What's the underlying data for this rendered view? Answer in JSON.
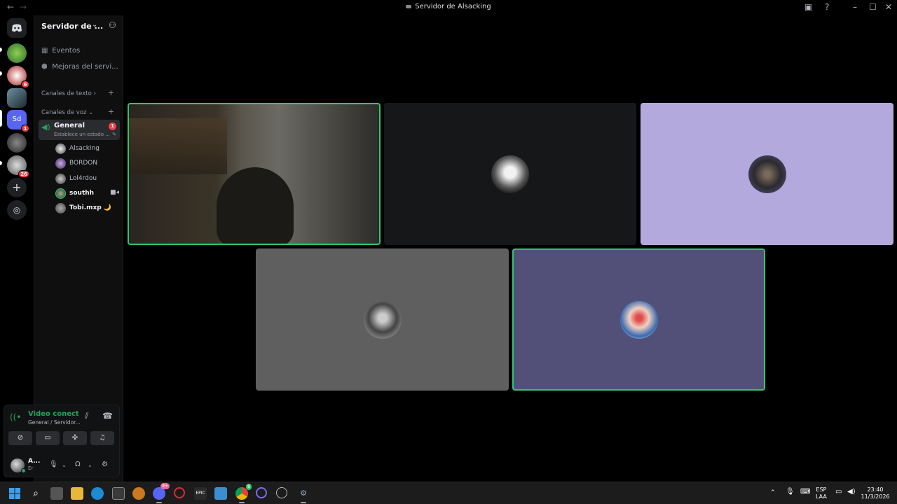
{
  "window": {
    "title": "Servidor de Alsacking"
  },
  "server": {
    "name": "Servidor de ...",
    "items": [
      {
        "label": "Eventos"
      },
      {
        "label": "Mejoras del servi..."
      }
    ],
    "categories": {
      "text": "Canales de texto",
      "voice": "Canales de voz"
    },
    "voice_channel": {
      "name": "General",
      "badge": "1",
      "status": "Establece un estado ..."
    },
    "members": [
      {
        "name": "Alsacking"
      },
      {
        "name": "BORDON"
      },
      {
        "name": "Lol4rdou"
      },
      {
        "name": "southh"
      },
      {
        "name": "Tobi.mxp 🌙"
      }
    ]
  },
  "guild_badges": [
    "6",
    "1",
    "26"
  ],
  "guild_extra": {
    "active_label": "Sd"
  },
  "voice_panel": {
    "title": "Video conectac",
    "subtitle": "General / Servidor..."
  },
  "user": {
    "name": "A...",
    "status": "Er"
  },
  "taskbar": {
    "discord_badge": "9+",
    "chrome_badge": "8",
    "lang_top": "ESP",
    "lang_bottom": "LAA",
    "time": "23:40",
    "date": "11/3/2026"
  },
  "colors": {
    "speaking_border": "#2dc770",
    "tile_dark": "#161719",
    "tile_lavender": "#b3a9dd",
    "tile_gray": "#5f5f5f",
    "tile_indigo": "#525078"
  },
  "icons": [
    "discord-icon",
    "plus-icon",
    "compass-icon",
    "calendar-icon",
    "shield-icon",
    "speaker-icon",
    "video-camera-icon",
    "signal-icon",
    "hangup-icon",
    "mic-icon",
    "headphones-icon",
    "gear-icon",
    "windows-icon",
    "search-icon"
  ]
}
